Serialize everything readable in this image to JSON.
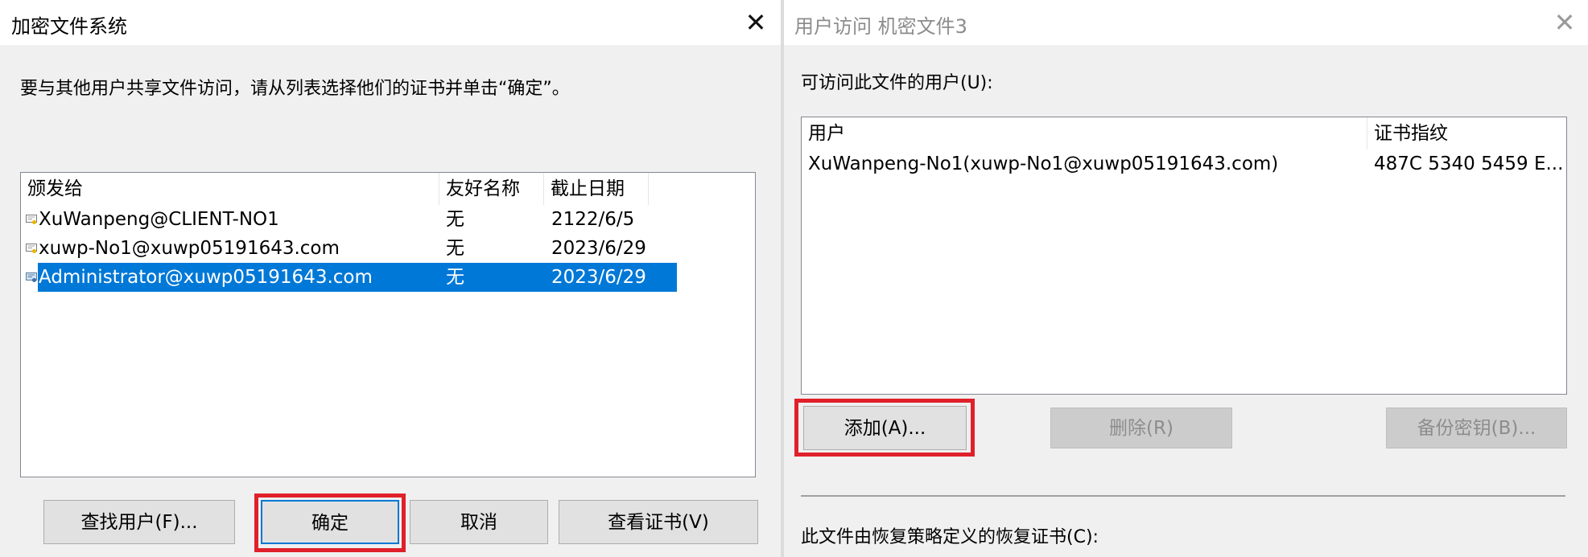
{
  "left_dialog": {
    "title": "加密文件系统",
    "close_glyph": "✕",
    "instruction": "要与其他用户共享文件访问，请从列表选择他们的证书并单击“确定”。",
    "columns": [
      "颁发给",
      "友好名称",
      "截止日期"
    ],
    "rows": [
      {
        "issued_to": "XuWanpeng@CLIENT-NO1",
        "friendly_name": "无",
        "expiry": "2122/6/5",
        "selected": false
      },
      {
        "issued_to": "xuwp-No1@xuwp05191643.com",
        "friendly_name": "无",
        "expiry": "2023/6/29",
        "selected": false
      },
      {
        "issued_to": "Administrator@xuwp05191643.com",
        "friendly_name": "无",
        "expiry": "2023/6/29",
        "selected": true
      }
    ],
    "buttons": {
      "find_user": "查找用户(F)...",
      "ok": "确定",
      "cancel": "取消",
      "view_cert": "查看证书(V)"
    }
  },
  "right_dialog": {
    "title": "用户访问 机密文件3",
    "close_glyph": "✕",
    "users_label": "可访问此文件的用户(U):",
    "columns": [
      "用户",
      "证书指纹"
    ],
    "rows": [
      {
        "user": "XuWanpeng-No1(xuwp-No1@xuwp05191643.com)",
        "thumbprint": "487C 5340 5459 E..."
      }
    ],
    "buttons": {
      "add": "添加(A)...",
      "remove": "删除(R)",
      "backup_key": "备份密钥(B)..."
    },
    "recovery_label": "此文件由恢复策略定义的恢复证书(C):"
  },
  "colors": {
    "selection": "#0078d7",
    "highlight_box": "#e0202a",
    "dialog_bg": "#f0f0f0"
  }
}
